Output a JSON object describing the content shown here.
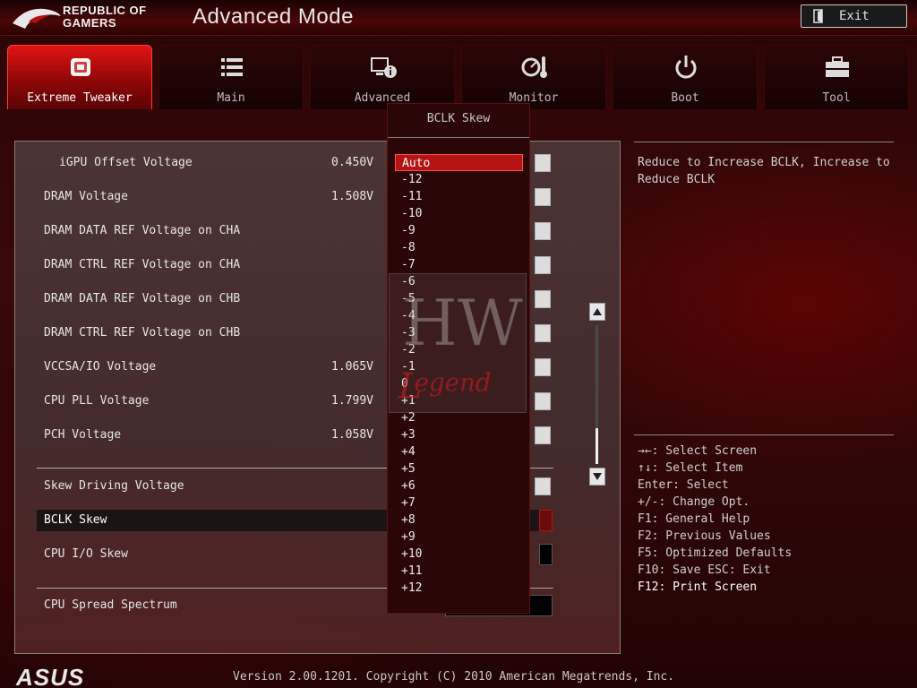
{
  "header": {
    "brand_line1": "REPUBLIC OF",
    "brand_line2": "GAMERS",
    "mode_title": "Advanced Mode",
    "exit_label": "Exit"
  },
  "tabs": [
    {
      "label": "Extreme Tweaker",
      "icon": "tweaker-icon",
      "active": true
    },
    {
      "label": "Main",
      "icon": "list-icon"
    },
    {
      "label": "Advanced",
      "icon": "advanced-info-icon"
    },
    {
      "label": "Monitor",
      "icon": "monitor-gauge-icon"
    },
    {
      "label": "Boot",
      "icon": "power-icon"
    },
    {
      "label": "Tool",
      "icon": "toolbox-icon"
    }
  ],
  "settings": [
    {
      "label": "iGPU Offset Voltage",
      "value": "0.450V"
    },
    {
      "label": "DRAM Voltage",
      "value": "1.508V"
    },
    {
      "label": "DRAM DATA REF Voltage on CHA",
      "value": ""
    },
    {
      "label": "DRAM CTRL REF Voltage on CHA",
      "value": ""
    },
    {
      "label": "DRAM DATA REF Voltage on CHB",
      "value": ""
    },
    {
      "label": "DRAM CTRL REF Voltage on CHB",
      "value": ""
    },
    {
      "label": "VCCSA/IO Voltage",
      "value": "1.065V"
    },
    {
      "label": "CPU PLL Voltage",
      "value": "1.799V"
    },
    {
      "label": "PCH Voltage",
      "value": "1.058V"
    },
    {
      "label": "Skew Driving Voltage",
      "value": ""
    },
    {
      "label": "BCLK Skew",
      "value": ""
    },
    {
      "label": "CPU I/O Skew",
      "value": ""
    },
    {
      "label": "CPU Spread Spectrum",
      "value": ""
    }
  ],
  "dropdown": {
    "title": "BCLK Skew",
    "selected": "Auto",
    "options": [
      "Auto",
      "-12",
      "-11",
      "-10",
      "-9",
      "-8",
      "-7",
      "-6",
      "-5",
      "-4",
      "-3",
      "-2",
      "-1",
      "0",
      "+1",
      "+2",
      "+3",
      "+4",
      "+5",
      "+6",
      "+7",
      "+8",
      "+9",
      "+10",
      "+11",
      "+12"
    ]
  },
  "help": {
    "description": "Reduce to Increase BCLK, Increase to Reduce BCLK",
    "keys": [
      "→←: Select Screen",
      "↑↓: Select Item",
      "Enter: Select",
      "+/-: Change Opt.",
      "F1: General Help",
      "F2: Previous Values",
      "F5: Optimized Defaults",
      "F10: Save  ESC: Exit",
      "F12: Print Screen"
    ]
  },
  "footer": {
    "logo": "ASUS",
    "version": "Version 2.00.1201. Copyright (C) 2010 American Megatrends, Inc."
  },
  "watermark": {
    "text": "HW Legend"
  },
  "colors": {
    "accent": "#b41414",
    "active_tab": "#e01414",
    "panel_bg": "#4e3c3c"
  }
}
